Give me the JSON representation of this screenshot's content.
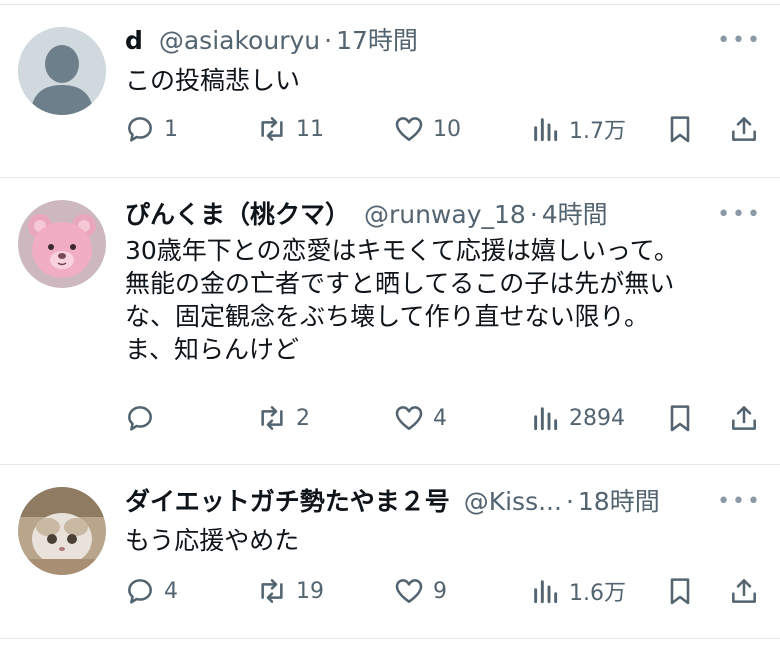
{
  "tweets": [
    {
      "name": "d",
      "handle": "@asiakouryu",
      "sep": "·",
      "time": "17時間",
      "more": "•••",
      "avatar_icon": "default-avatar-icon",
      "lines": [
        "この投稿悲しい"
      ],
      "replies": "1",
      "retweets": "11",
      "likes": "10",
      "views": "1.7万"
    },
    {
      "name": "ぴんくま（桃クマ）",
      "handle": "@runway_18",
      "sep": "·",
      "time": "4時間",
      "more": "•••",
      "avatar_icon": "pink-teddy-bear-icon",
      "lines": [
        "30歳年下との恋愛はキモくて応援は嬉しいって。",
        "無能の金の亡者ですと晒してるこの子は先が無い",
        "な、固定観念をぶち壊して作り直せない限り。",
        "ま、知らんけど"
      ],
      "replies": "",
      "retweets": "2",
      "likes": "4",
      "views": "2894"
    },
    {
      "name": "ダイエットガチ勢たやま２号",
      "handle": "@Kiss...",
      "sep": "·",
      "time": "18時間",
      "more": "•••",
      "avatar_icon": "cat-photo-icon",
      "lines": [
        "もう応援やめた"
      ],
      "replies": "4",
      "retweets": "19",
      "likes": "9",
      "views": "1.6万"
    }
  ],
  "colors": {
    "text": "#0f1419",
    "meta": "#536471",
    "divider": "#e6e9eb",
    "default_avatar_bg": "#cfd9de"
  }
}
